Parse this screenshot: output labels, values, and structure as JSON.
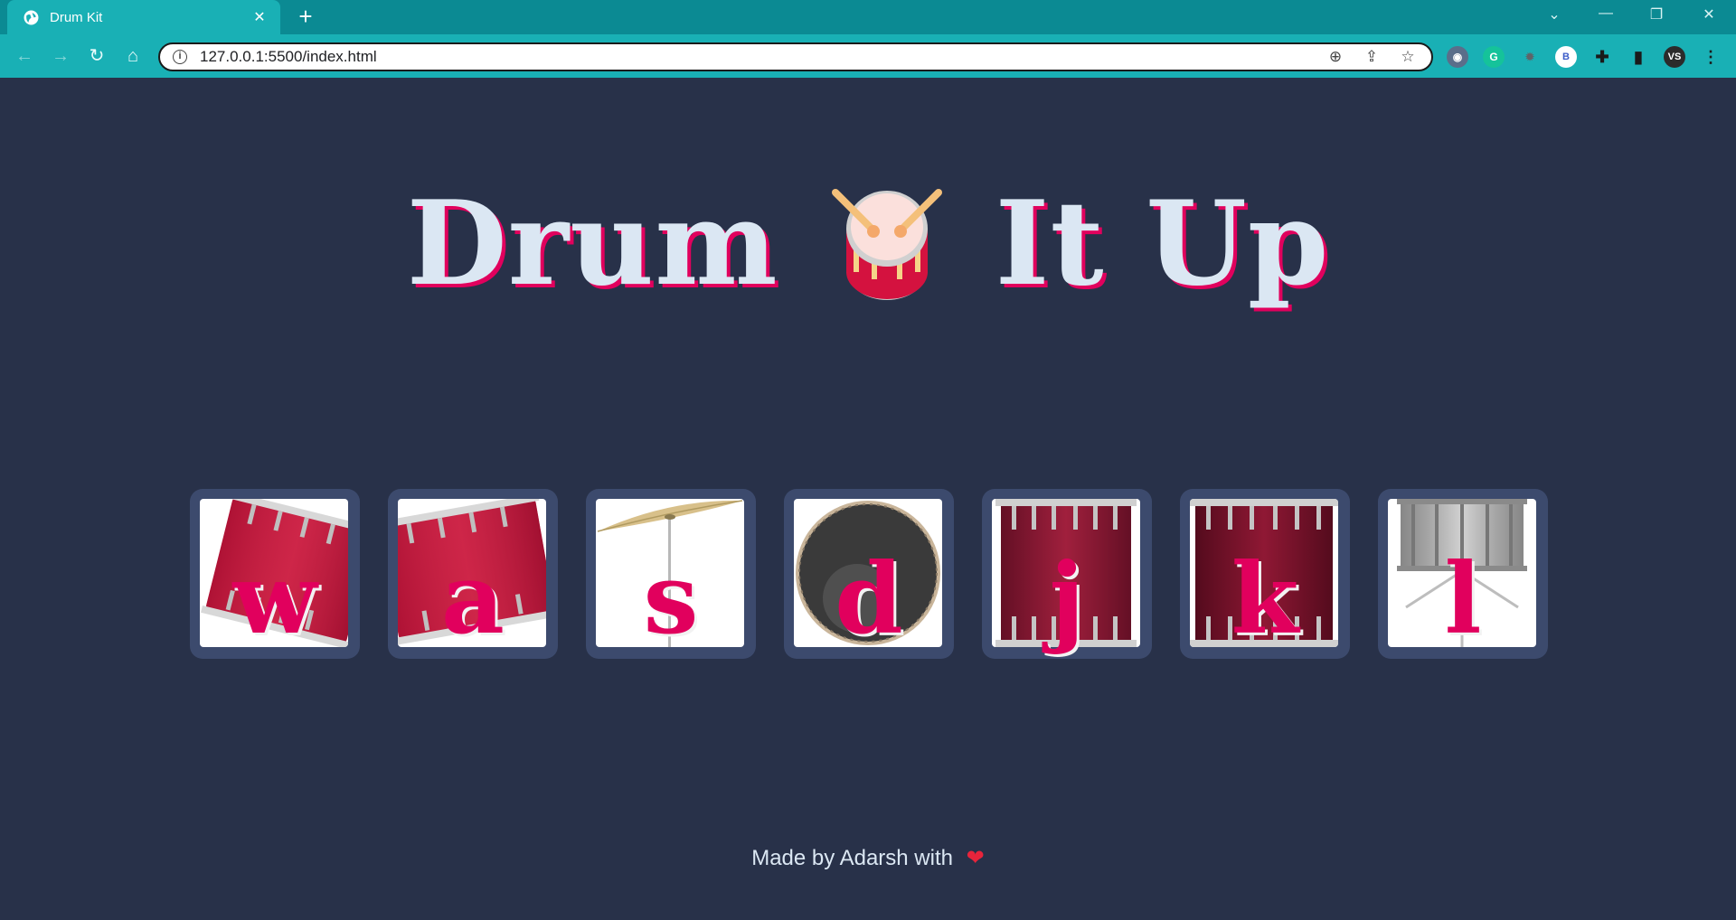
{
  "browser": {
    "tab_title": "Drum Kit",
    "new_tab_symbol": "+",
    "url": "127.0.0.1:5500/index.html",
    "profile_initials": "VS",
    "extension_initial": "B",
    "grammarly_initial": "G"
  },
  "page": {
    "heading_left": "Drum",
    "heading_right": "It Up",
    "keys": [
      {
        "letter": "w",
        "instrument": "tom-1"
      },
      {
        "letter": "a",
        "instrument": "tom-2"
      },
      {
        "letter": "s",
        "instrument": "crash"
      },
      {
        "letter": "d",
        "instrument": "kick-bass"
      },
      {
        "letter": "j",
        "instrument": "tom-3"
      },
      {
        "letter": "k",
        "instrument": "tom-4"
      },
      {
        "letter": "l",
        "instrument": "snare"
      }
    ],
    "footer_text": "Made by Adarsh with",
    "footer_heart": "❤"
  },
  "colors": {
    "background": "#283149",
    "key_border": "#3c4a6d",
    "accent": "#e1005d",
    "heading_text": "#dbe7f3",
    "chrome_tabbar": "#0b8a93",
    "chrome_toolbar": "#19b0b5"
  }
}
